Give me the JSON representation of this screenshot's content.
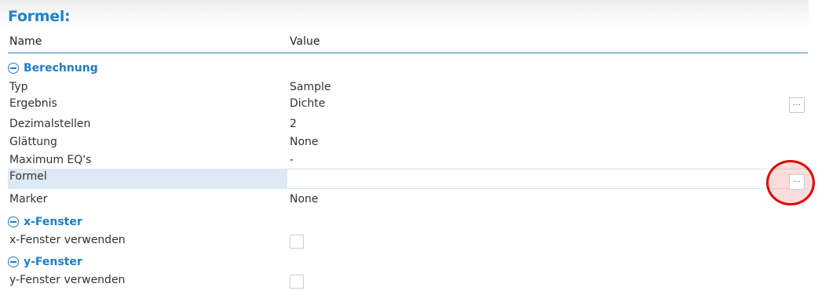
{
  "header": {
    "title": "Formel:"
  },
  "columns": {
    "name": "Name",
    "value": "Value"
  },
  "groups": {
    "berechnung": {
      "label": "Berechnung",
      "rows": {
        "typ": {
          "name": "Typ",
          "value": "Sample"
        },
        "ergebnis": {
          "name": "Ergebnis",
          "value": "Dichte",
          "button": "..."
        },
        "dezimalstellen": {
          "name": "Dezimalstellen",
          "value": "2"
        },
        "glaettung": {
          "name": "Glättung",
          "value": "None"
        },
        "maximum": {
          "name": "Maximum EQ's",
          "value": "-"
        },
        "formel": {
          "name": "Formel",
          "value": "",
          "button": "..."
        },
        "marker": {
          "name": "Marker",
          "value": "None"
        }
      }
    },
    "xfenster": {
      "label": "x-Fenster",
      "rows": {
        "verwenden": {
          "name": "x-Fenster verwenden",
          "checked": false
        }
      }
    },
    "yfenster": {
      "label": "y-Fenster",
      "rows": {
        "verwenden": {
          "name": "y-Fenster verwenden",
          "checked": false
        }
      }
    }
  },
  "colors": {
    "accent": "#1f85c4",
    "selected_row": "#dde9f5",
    "highlight": "#e00000"
  }
}
